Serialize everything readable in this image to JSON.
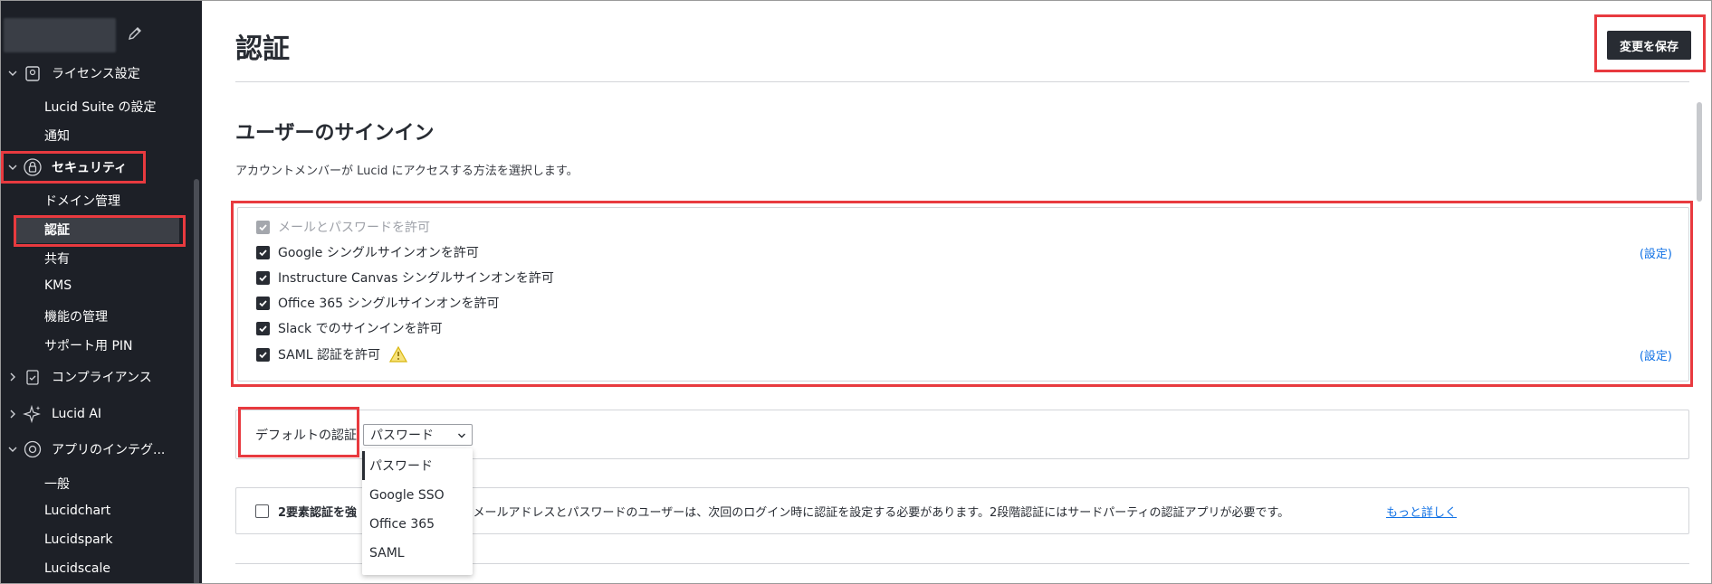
{
  "sidebar": {
    "sections": [
      {
        "label": "ライセンス設定",
        "expanded": true,
        "icon": "license-icon"
      },
      {
        "label": "セキュリティ",
        "expanded": true,
        "icon": "lock-shield-icon"
      },
      {
        "label": "コンプライアンス",
        "expanded": false,
        "icon": "clipboard-check-icon"
      },
      {
        "label": "Lucid AI",
        "expanded": false,
        "icon": "sparkle-icon"
      },
      {
        "label": "アプリのインテグ...",
        "expanded": true,
        "icon": "integration-icon"
      }
    ],
    "items": [
      "Lucid Suite の設定",
      "通知",
      "ドメイン管理",
      "認証",
      "共有",
      "KMS",
      "機能の管理",
      "サポート用 PIN",
      "一般",
      "Lucidchart",
      "Lucidspark",
      "Lucidscale"
    ],
    "active_item": "認証"
  },
  "header": {
    "title": "認証",
    "save_label": "変更を保存"
  },
  "signin": {
    "title": "ユーザーのサインイン",
    "description": "アカウントメンバーが Lucid にアクセスする方法を選択します。",
    "options": [
      {
        "label": "メールとパスワードを許可",
        "checked": true,
        "disabled": true
      },
      {
        "label": "Google シングルサインオンを許可",
        "checked": true,
        "link": "(設定)"
      },
      {
        "label": "Instructure Canvas シングルサインオンを許可",
        "checked": true
      },
      {
        "label": "Office 365 シングルサインオンを許可",
        "checked": true
      },
      {
        "label": "Slack でのサインインを許可",
        "checked": true
      },
      {
        "label": "SAML 認証を許可",
        "checked": true,
        "warning": true,
        "link": "(設定)"
      }
    ]
  },
  "default_auth": {
    "label": "デフォルトの認証",
    "selected": "パスワード",
    "options": [
      "パスワード",
      "Google SSO",
      "Office 365",
      "SAML"
    ]
  },
  "two_factor": {
    "bold_label": "2要素認証を強",
    "text_visible": "すると、メールアドレスとパスワードのユーザーは、次回のログイン時に認証を設定する必要があります。2段階認証にはサードパーティの認証アプリが必要です。",
    "link": "もっと詳しく",
    "checked": false
  },
  "colors": {
    "sidebar_bg": "#1d2027",
    "highlight": "#e83a3f",
    "link": "#1071e5",
    "button_bg": "#282c33"
  }
}
